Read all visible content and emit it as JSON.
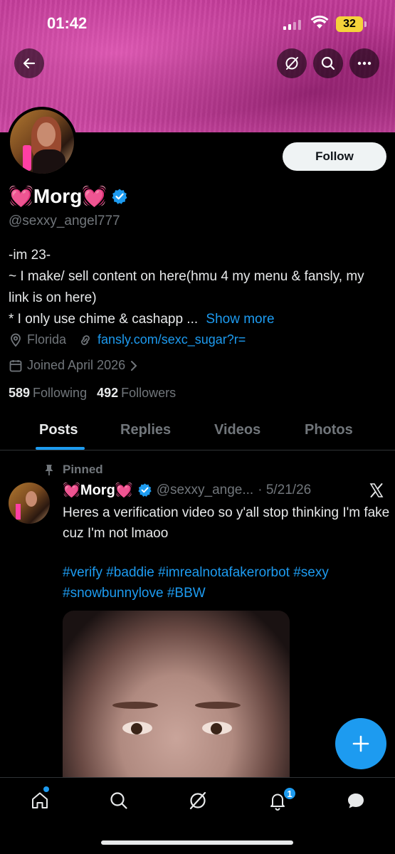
{
  "status_bar": {
    "time": "01:42",
    "battery": "32"
  },
  "profile": {
    "name": "💓Morg💓",
    "handle": "@sexxy_angel777",
    "follow_label": "Follow",
    "bio_line1": "-im 23-",
    "bio_line2": "~ I make/ sell content on here(hmu 4 my menu & fansly, my link is on here)",
    "bio_line3": "* I only use chime & cashapp ...",
    "show_more": "Show more",
    "location": "Florida",
    "website": "fansly.com/sexc_sugar?r=",
    "joined": "Joined April 2026",
    "following_count": "589",
    "following_label": "Following",
    "followers_count": "492",
    "followers_label": "Followers"
  },
  "tabs": [
    "Posts",
    "Replies",
    "Videos",
    "Photos"
  ],
  "post": {
    "pinned_label": "Pinned",
    "author_name": "💓Morg💓",
    "author_handle": "@sexxy_ange...",
    "date": "· 5/21/26",
    "text": "Heres a verification video so y'all stop thinking I'm fake cuz I'm not lmaoo",
    "tags": "#verify #baddie #imrealnotafakerorbot #sexy #snowbunnylove #BBW"
  },
  "nav": {
    "notification_count": "1"
  },
  "colors": {
    "accent": "#1d9bf0",
    "background": "#000000",
    "banner": "#c23a98"
  },
  "icons": [
    "back-arrow-icon",
    "grok-icon",
    "search-icon",
    "more-icon",
    "verified-badge-icon",
    "location-icon",
    "link-icon",
    "calendar-icon",
    "pin-icon",
    "x-logo-icon",
    "plus-icon",
    "home-icon",
    "chat-icon"
  ]
}
